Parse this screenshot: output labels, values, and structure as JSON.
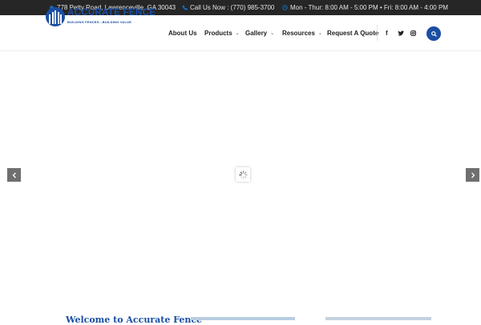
{
  "topbar": {
    "address": "778 Petty Road, Lawrenceville, GA 30043",
    "phone": "Call Us Now : (770) 985-3700",
    "hours": "Mon - Thur: 8:00 AM - 5:00 PM • Fri: 8:00 AM - 4:00 PM",
    "icon_color": "#1a6fc4"
  },
  "logo": {
    "title": "ACCURATE FENCE",
    "tagline": "BUILDING FENCES...BUILDING VALUE",
    "brand_color": "#1a4ea3"
  },
  "nav": {
    "items": [
      {
        "label": "About Us",
        "dropdown": false
      },
      {
        "label": "Products",
        "dropdown": true
      },
      {
        "label": "Gallery",
        "dropdown": true
      },
      {
        "label": "Resources",
        "dropdown": true
      },
      {
        "label": "Request A Quote",
        "dropdown": false
      }
    ]
  },
  "social": {
    "facebook": "f",
    "twitter": "twitter-icon",
    "instagram": "instagram-icon"
  },
  "slider": {
    "prev_icon": "chevron-left-icon",
    "next_icon": "chevron-right-icon",
    "loading_icon": "loading-spinner-icon"
  },
  "welcome": {
    "heading": "Welcome to Accurate Fence"
  }
}
